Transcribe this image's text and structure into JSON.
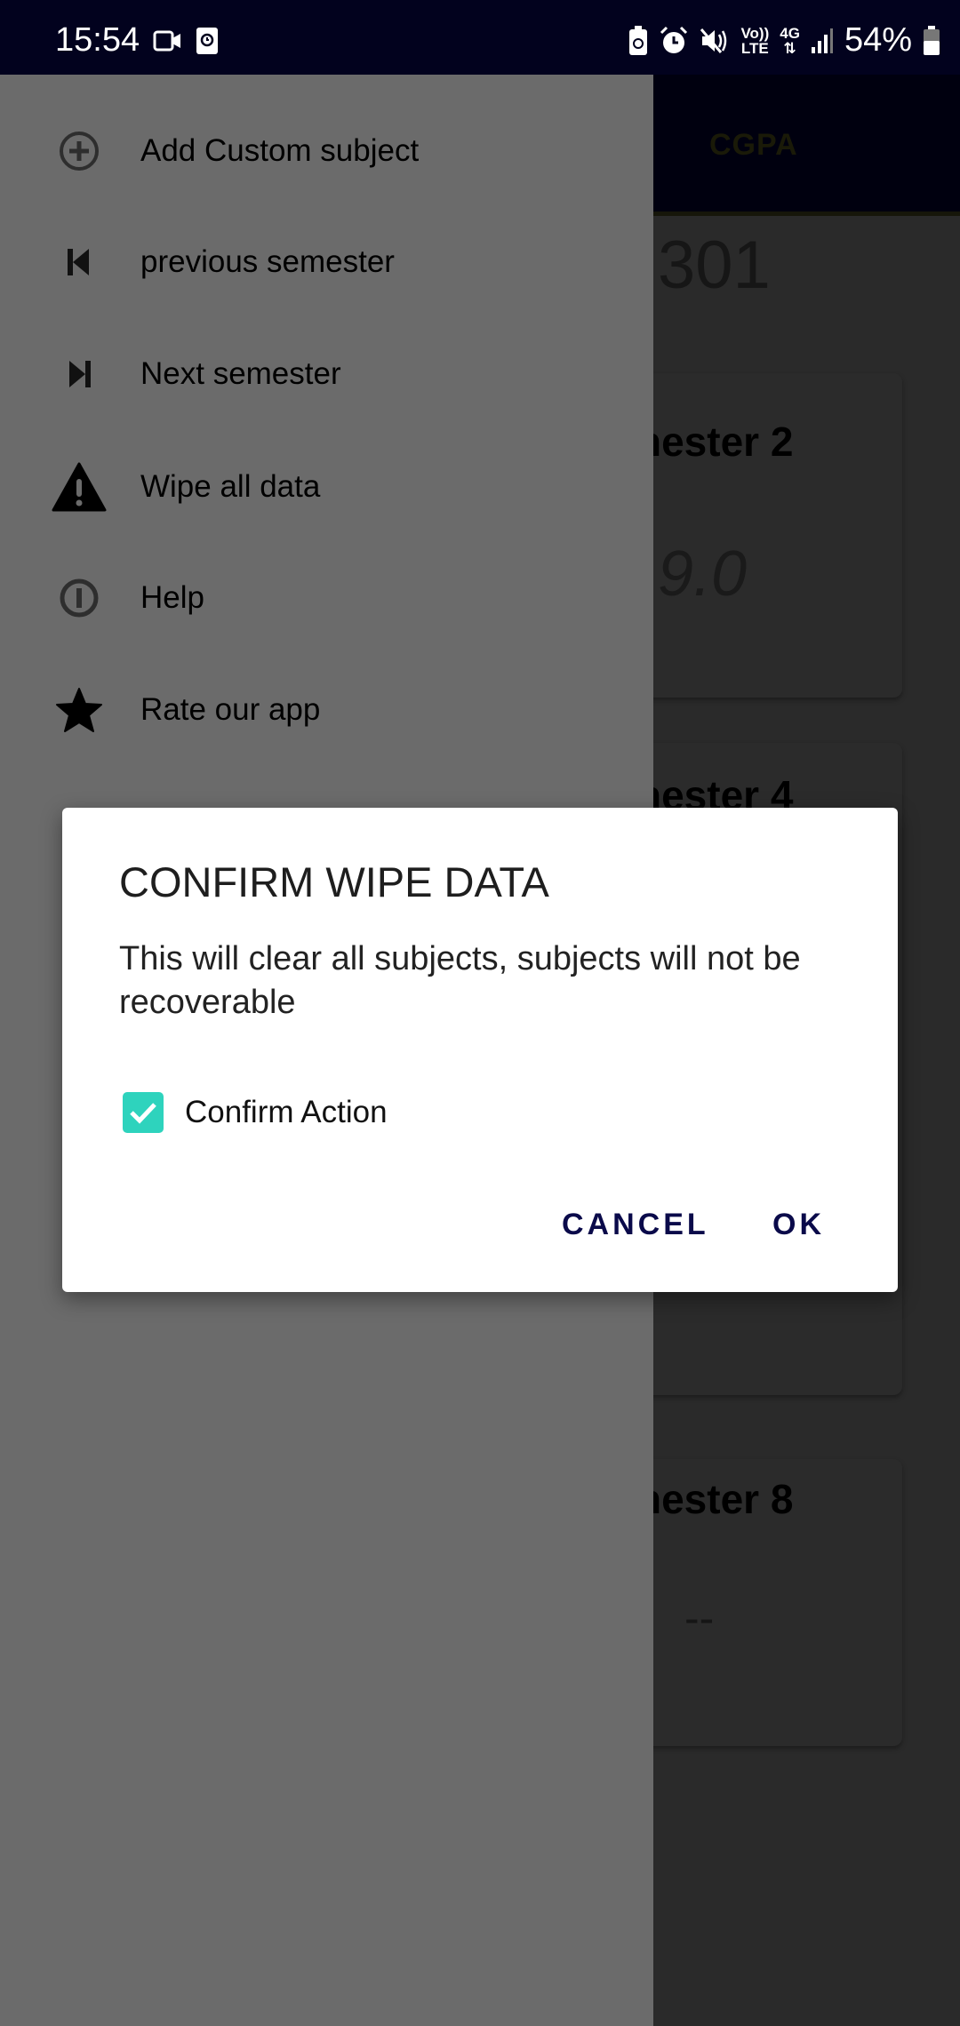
{
  "status_bar": {
    "time": "15:54",
    "battery": "54%",
    "network_volte": "Vo))\nLTE",
    "network_type": "4G",
    "icons": [
      "video-camera-icon",
      "screen-record-icon",
      "battery-saver-icon",
      "alarm-icon",
      "mute-icon",
      "volte-icon",
      "4g-data-icon",
      "signal-icon",
      "battery-icon"
    ]
  },
  "background_app": {
    "tab_label": "CGPA",
    "big_number": "301",
    "cards": [
      {
        "title": "nester 2",
        "value": "9.0"
      },
      {
        "title": "nester 4",
        "value": ""
      },
      {
        "title": "nester 8",
        "value": "--"
      }
    ]
  },
  "drawer": {
    "items": [
      {
        "label": "Add Custom subject",
        "icon": "add-circle-icon"
      },
      {
        "label": "previous semester",
        "icon": "skip-previous-icon"
      },
      {
        "label": "Next semester",
        "icon": "skip-next-icon"
      },
      {
        "label": "Wipe all data",
        "icon": "warning-icon"
      },
      {
        "label": "Help",
        "icon": "info-icon"
      },
      {
        "label": "Rate our app",
        "icon": "star-icon"
      }
    ]
  },
  "dialog": {
    "title": "CONFIRM WIPE DATA",
    "message": "This will clear all subjects, subjects will not be recoverable",
    "checkbox_label": "Confirm Action",
    "checkbox_checked": true,
    "checkbox_color": "#2ed3bd",
    "cancel_label": "CANCEL",
    "ok_label": "OK",
    "button_color": "#0a0a4a"
  }
}
